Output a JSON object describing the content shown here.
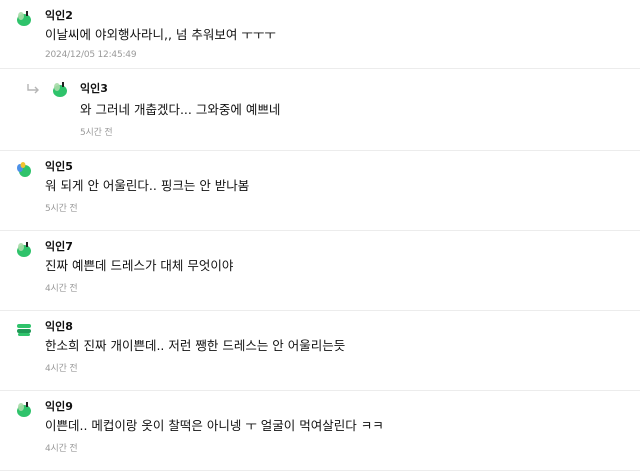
{
  "comments": [
    {
      "author": "익인2",
      "text": "이날씨에 야외행사라니,, 넘 추워보여 ㅜㅜㅜ",
      "time": "2024/12/05 12:45:49",
      "kind": "top",
      "avatar_colors": [
        "#2fc36b",
        "#a7dca9"
      ]
    },
    {
      "author": "익인3",
      "text": "와 그러네 개춥겠다... 그와중에 예쁘네",
      "time": "5시간 전",
      "kind": "reply",
      "avatar_colors": [
        "#2fc36b",
        "#a7dca9"
      ]
    },
    {
      "author": "익인5",
      "text": "워 되게 안 어울린다.. 핑크는 안 받나봄",
      "time": "5시간 전",
      "kind": "item",
      "avatar_colors": [
        "#2fc36b",
        "#f2c230",
        "#4c90e8"
      ]
    },
    {
      "author": "익인7",
      "text": "진짜 예쁜데 드레스가 대체 무엇이야",
      "time": "4시간 전",
      "kind": "item",
      "avatar_colors": [
        "#2fc36b",
        "#a7dca9"
      ]
    },
    {
      "author": "익인8",
      "text": "한소희 진짜 개이쁜데.. 저런 쨍한 드레스는 안 어울리는듯",
      "time": "4시간 전",
      "kind": "item",
      "avatar_colors": [
        "#2fc36b",
        "#1f9a56"
      ]
    },
    {
      "author": "익인9",
      "text": "이쁜데.. 메컵이랑 옷이 찰떡은 아니넹 ㅜ 얼굴이 먹여살린다 ㅋㅋ",
      "time": "4시간 전",
      "kind": "item",
      "avatar_colors": [
        "#2fc36b",
        "#a7dca9"
      ]
    }
  ],
  "icons": {
    "avatar": "beanie-avatar-icon",
    "reply": "reply-arrow-icon"
  }
}
